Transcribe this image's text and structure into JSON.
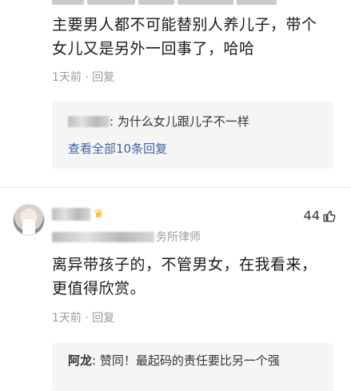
{
  "comment1": {
    "text_line1": "主要男人都不可能替别人养儿子，带个",
    "text_line2": "女儿又是另外一回事了，哈哈",
    "time": "1天前",
    "dot": "·",
    "reply_label": "回复",
    "sub_reply": {
      "text": ": 为什么女儿跟儿子不一样",
      "view_all": "查看全部10条回复"
    }
  },
  "comment2": {
    "user_title_suffix": "务所律师",
    "likes": "44",
    "text_line1": "离异带孩子的，不管男女，在我看来，",
    "text_line2": "更值得欣赏。",
    "time": "1天前",
    "dot": "·",
    "reply_label": "回复",
    "sub_reply": {
      "author": "阿龙",
      "text": ": 赞同！最起码的责任要比另一个强"
    }
  },
  "colors": {
    "link": "#3b63a8",
    "meta": "#9a9a9a",
    "reply_bg": "#f5f5f5",
    "crown": "#f2b300"
  },
  "icons": [
    "crown-icon",
    "thumb-up-icon",
    "avatar"
  ]
}
